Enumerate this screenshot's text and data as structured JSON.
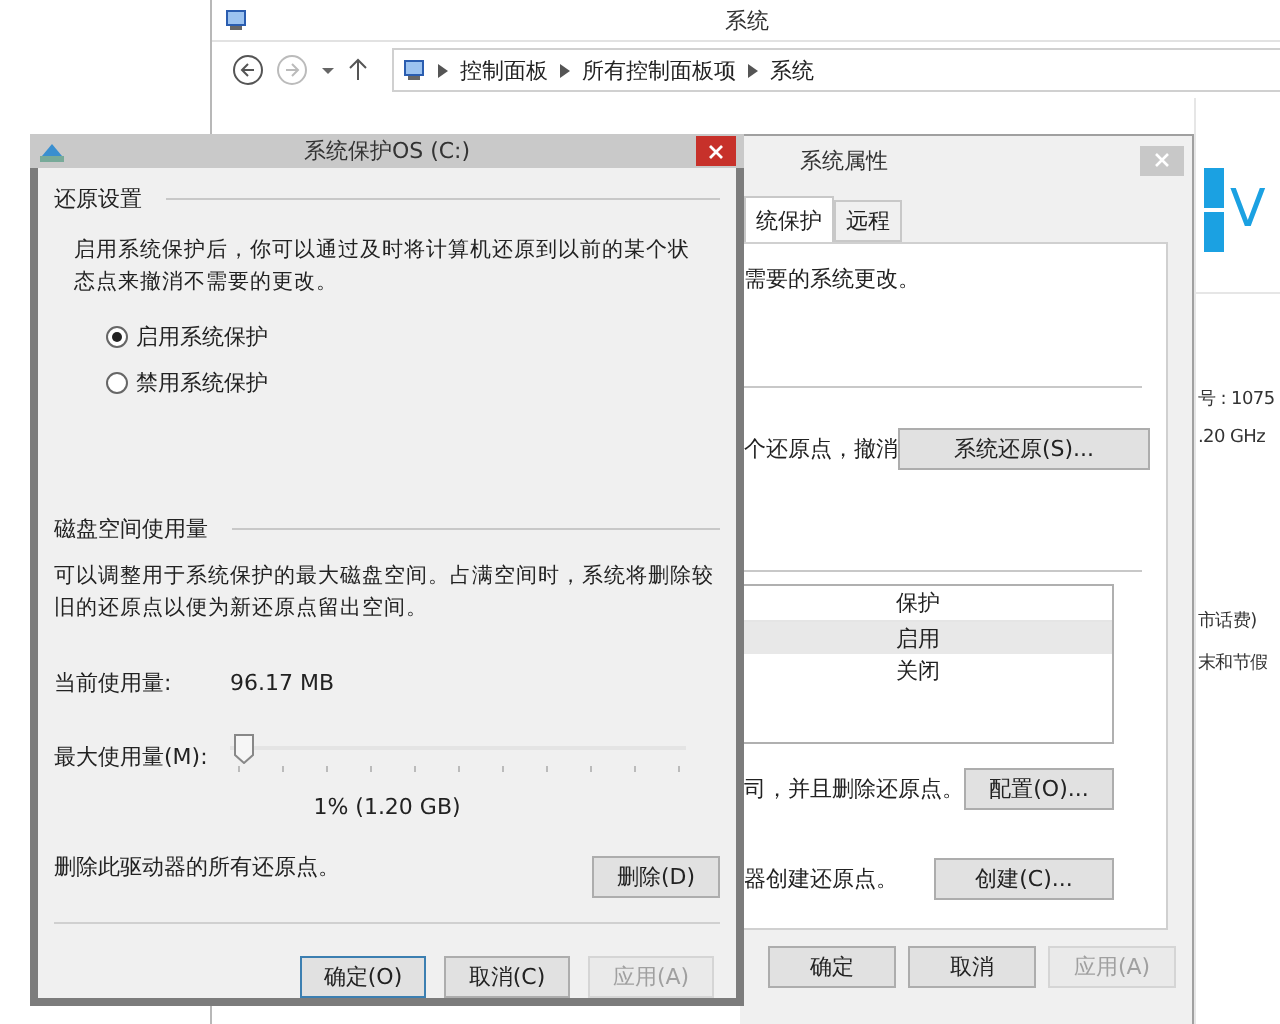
{
  "system_window": {
    "title": "系统",
    "breadcrumbs": [
      "控制面板",
      "所有控制面板项",
      "系统"
    ],
    "logo_text": "V",
    "info_texts": [
      "号 : 1075",
      ".20 GHz"
    ],
    "info_texts_lower": [
      "市话费)",
      "末和节假"
    ]
  },
  "properties_window": {
    "title": "系统属性",
    "tabs": [
      {
        "label": "统保护",
        "selected": true
      },
      {
        "label": "远程",
        "selected": false
      }
    ],
    "intro": "需要的系统更改。",
    "restore_text": "个还原点，撤消",
    "restore_button": "系统还原(S)...",
    "table": {
      "columns": [
        "保护"
      ],
      "rows": [
        {
          "cells": [
            "启用"
          ],
          "selected": true
        },
        {
          "cells": [
            "关闭"
          ],
          "selected": false
        }
      ]
    },
    "config_text": "司，并且删除还原点。",
    "config_button": "配置(O)...",
    "create_text": "器创建还原点。",
    "create_button": "创建(C)...",
    "buttons": [
      {
        "label": "确定",
        "disabled": false
      },
      {
        "label": "取消",
        "disabled": false
      },
      {
        "label": "应用(A)",
        "disabled": true
      }
    ]
  },
  "dialog": {
    "title": "系统保护OS (C:)",
    "restore_section": {
      "heading": "还原设置",
      "description": "启用系统保护后，你可以通过及时将计算机还原到以前的某个状态点来撤消不需要的更改。",
      "options": [
        {
          "label": "启用系统保护",
          "selected": true
        },
        {
          "label": "禁用系统保护",
          "selected": false
        }
      ]
    },
    "disk_section": {
      "heading": "磁盘空间使用量",
      "description": "可以调整用于系统保护的最大磁盘空间。占满空间时，系统将删除较旧的还原点以便为新还原点留出空间。",
      "current_label": "当前使用量:",
      "current_value": "96.17 MB",
      "max_label": "最大使用量(M):",
      "max_slider": {
        "level": 0.01
      },
      "max_reading": "1% (1.20 GB)",
      "delete_text": "删除此驱动器的所有还原点。",
      "delete_button": "删除(D)"
    },
    "buttons": [
      {
        "label": "确定(O)",
        "disabled": false,
        "default": true
      },
      {
        "label": "取消(C)",
        "disabled": false,
        "default": false
      },
      {
        "label": "应用(A)",
        "disabled": true,
        "default": false
      }
    ]
  }
}
